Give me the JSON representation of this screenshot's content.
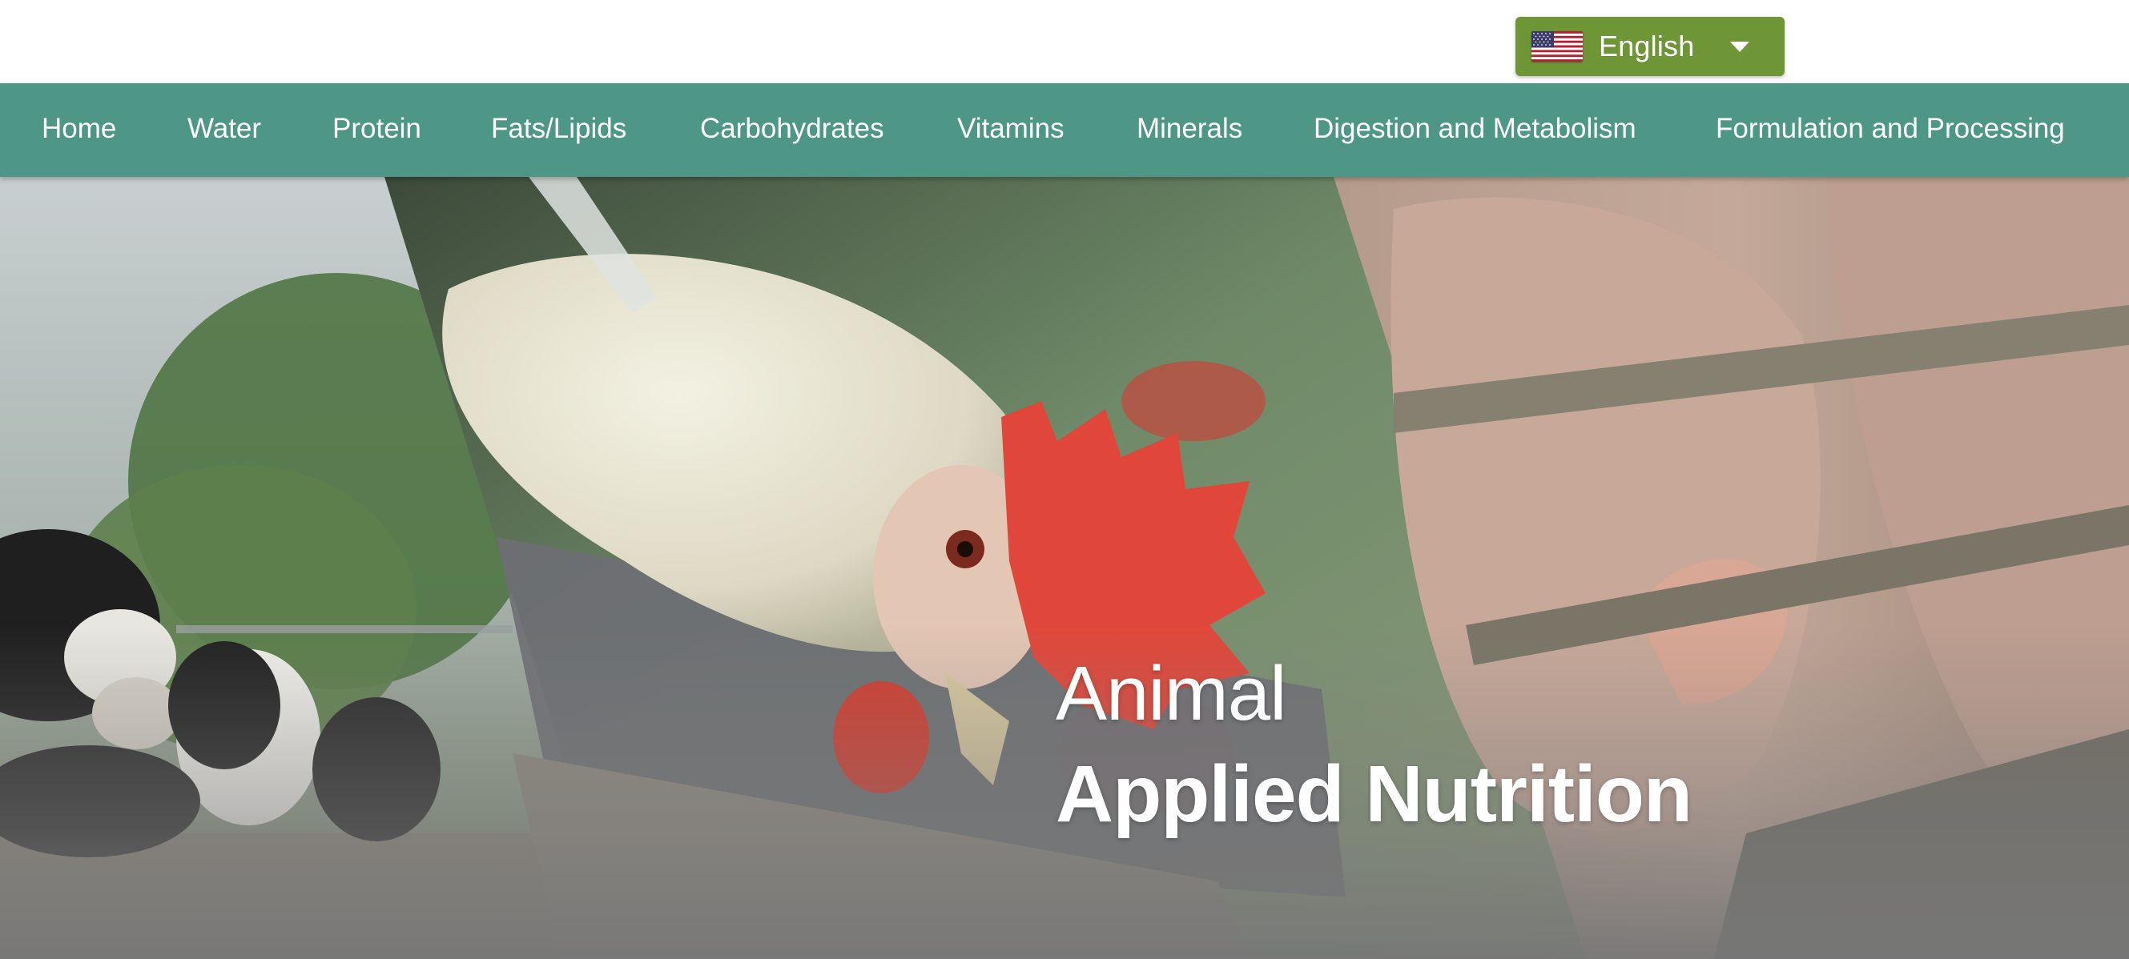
{
  "language_selector": {
    "label": "English",
    "flag_icon": "us-flag-icon",
    "background_color": "#6f9636"
  },
  "nav": {
    "background_color": "#4e9787",
    "items": [
      {
        "label": "Home"
      },
      {
        "label": "Water"
      },
      {
        "label": "Protein"
      },
      {
        "label": "Fats/Lipids"
      },
      {
        "label": "Carbohydrates"
      },
      {
        "label": "Vitamins"
      },
      {
        "label": "Minerals"
      },
      {
        "label": "Digestion and Metabolism"
      },
      {
        "label": "Formulation and Processing"
      }
    ]
  },
  "hero": {
    "title_line1": "Animal",
    "title_line2": "Applied Nutrition",
    "panels": [
      "cows-photo",
      "chicken-photo",
      "pigs-photo"
    ]
  }
}
